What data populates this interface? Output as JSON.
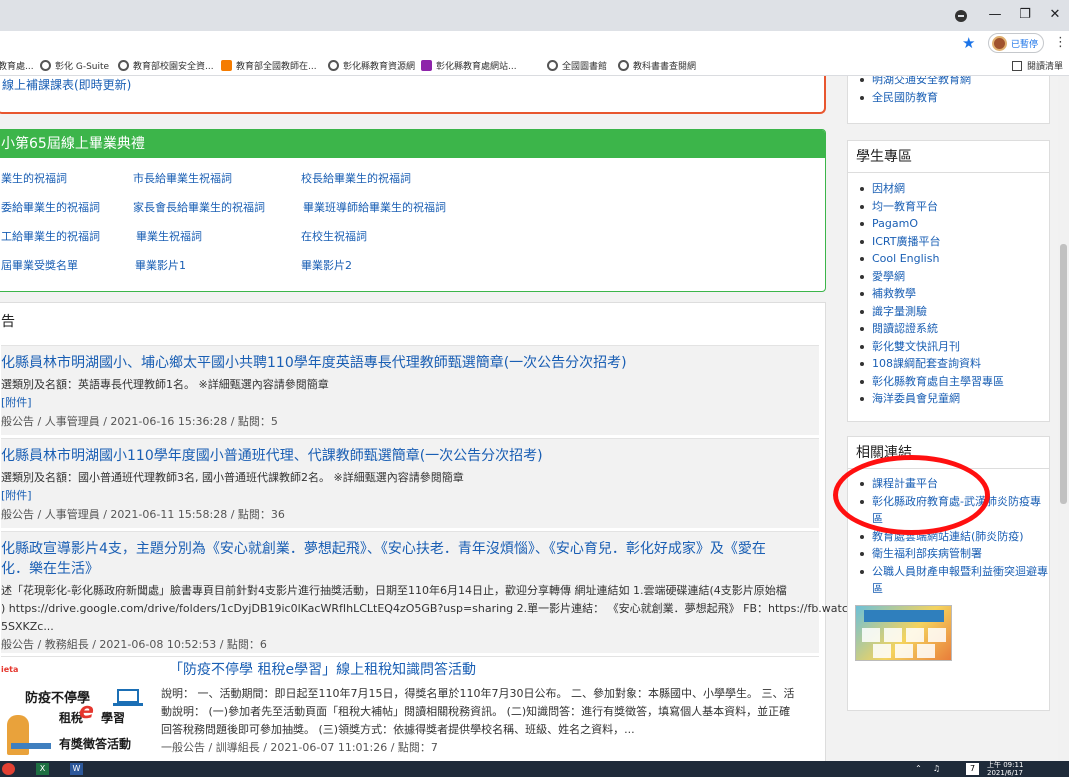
{
  "browser": {
    "profile_label": "已暫停",
    "bookmarks": [
      {
        "label": "教育處..."
      },
      {
        "label": "彰化 G-Suite"
      },
      {
        "label": "教育部校園安全資..."
      },
      {
        "label": "教育部全國教師在..."
      },
      {
        "label": "彰化縣教育資源網"
      },
      {
        "label": "彰化縣教育處網站..."
      },
      {
        "label": "全國圖書館"
      },
      {
        "label": "教科書書查閱網"
      }
    ],
    "bookmarks_folder": "閱讀清單"
  },
  "top_box": {
    "link": "線上補課課表(即時更新)"
  },
  "graduation": {
    "header": "小第65屆線上畢業典禮",
    "links": [
      [
        "業生的祝福詞",
        "市長給畢業生祝福詞",
        "校長給畢業生的祝福詞"
      ],
      [
        "委給畢業生的祝福詞",
        "家長會長給畢業生的祝福詞",
        "畢業班導師給畢業生的祝福詞"
      ],
      [
        "工給畢業生的祝福詞",
        "畢業生祝福詞",
        "在校生祝福詞"
      ],
      [
        "屆畢業受獎名單",
        "畢業影片1",
        "畢業影片2"
      ]
    ]
  },
  "announcements": {
    "title": "告",
    "items": [
      {
        "title": "化縣員林市明湖國小、埔心鄉太平國小共聘110學年度英語專長代理教師甄選簡章(一次公告分次招考)",
        "desc": "選類別及名額：英語專長代理教師1名。 ※詳細甄選內容請參閱簡章",
        "attach": "[附件]",
        "meta": "般公告 / 人事管理員 / 2021-06-16 15:36:28 / 點閱：5"
      },
      {
        "title": "化縣員林市明湖國小110學年度國小普通班代理、代課教師甄選簡章(一次公告分次招考)",
        "desc": "選類別及名額：國小普通班代理教師3名, 國小普通班代課教師2名。 ※詳細甄選內容請參閱簡章",
        "attach": "[附件]",
        "meta": "般公告 / 人事管理員 / 2021-06-11 15:58:28 / 點閱：36"
      },
      {
        "title": "化縣政宣導影片4支，主題分別為《安心就創業．夢想起飛》、《安心扶老．青年沒煩惱》、《安心育兒．彰化好成家》及《愛在",
        "title2": "化．樂在生活》",
        "desc": "述「花現彰化-彰化縣政府新聞處」臉書專頁目前針對4支影片進行抽獎活動，日期至110年6月14日止，歡迎分享轉傳 網址連結如 1.雲端硬碟連結(4支影片原始檔",
        "desc2": ") https://drive.google.com/drive/folders/1cDyjDB19ic0lKacWRfIhLCLtEQ4zO5GB?usp=sharing 2.單一影片連結： 《安心就創業．夢想起飛》 FB：https://fb.watc",
        "desc3": "5SXKZc...",
        "meta": "般公告 / 教務組長 / 2021-06-08 10:52:53 / 點閱：6"
      },
      {
        "title": "「防疫不停學 租稅e學習」線上租稅知識問答活動",
        "desc": "說明： 一、活動期間：即日起至110年7月15日，得獎名單於110年7月30日公布。 二、參加對象：本縣國中、小學學生。 三、活",
        "desc2": "動說明： (一)參加者先至活動頁面「租稅大補帖」閱讀相關稅務資訊。 (二)知識問答：進行有獎徵答，填寫個人基本資料，並正確",
        "desc3": "回答稅務問題後即可參加抽獎。 (三)領獎方式：依據得獎者提供學校名稱、班級、姓名之資料，...",
        "meta": "一般公告 / 訓導組長 / 2021-06-07 11:01:26 / 點閱：7",
        "promo": {
          "brand": "ieta",
          "line1": "防疫不停學",
          "line2": "租稅",
          "e": "e",
          "line2b": "學習",
          "line3": "有獎徵答活動"
        }
      }
    ]
  },
  "sidebar": {
    "top_links": [
      "明湖交通安全教育網",
      "全民國防教育"
    ],
    "student_zone": {
      "title": "學生專區",
      "links": [
        "因材網",
        "均一教育平台",
        "PagamO",
        "ICRT廣播平台",
        "Cool English",
        "愛學網",
        "補救教學",
        "識字量測驗",
        "閱讀認證系統",
        "彰化雙文快訊月刊",
        "108課綱配套查詢資料",
        "彰化縣教育處自主學習專區",
        "海洋委員會兒童網"
      ]
    },
    "related_links": {
      "title": "相關連結",
      "links": [
        "課程計畫平台",
        "彰化縣政府教育處-武漢肺炎防疫專區",
        "教育處雲端網站連結(肺炎防疫)",
        "衛生福利部疾病管制署",
        "公職人員財產申報暨利益衝突迴避專區"
      ]
    }
  },
  "taskbar": {
    "time": "上午 09:11",
    "date": "2021/6/17"
  },
  "colors": {
    "accent": "#1a5fb4",
    "green": "#3cb54a",
    "red_box": "#e8562f",
    "highlight_circle": "#ff1010"
  }
}
